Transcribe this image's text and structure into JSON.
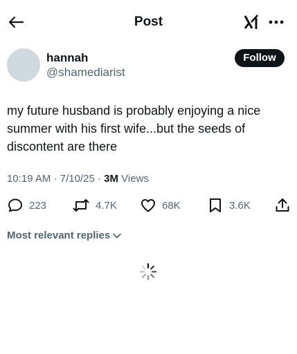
{
  "header": {
    "title": "Post",
    "back_icon": "arrow-left-icon",
    "grok_icon": "grok-icon",
    "more_icon": "more-horizontal-icon"
  },
  "author": {
    "display_name": "hannah",
    "handle": "@shamediarist",
    "follow_label": "Follow"
  },
  "post": {
    "text": "my future husband is probably enjoying a nice summer with his first wife...but the seeds of discontent are there",
    "time": "10:19 AM",
    "date": "7/10/25",
    "separator": "·",
    "views_count": "3M",
    "views_label": "Views"
  },
  "actions": {
    "replies": "223",
    "reposts": "4.7K",
    "likes": "68K",
    "bookmarks": "3.6K"
  },
  "replies_sort": {
    "label": "Most relevant replies"
  },
  "colors": {
    "text_primary": "#0f1419",
    "text_secondary": "#536471",
    "avatar_placeholder": "#cfd9de",
    "follow_bg": "#0f1419"
  }
}
